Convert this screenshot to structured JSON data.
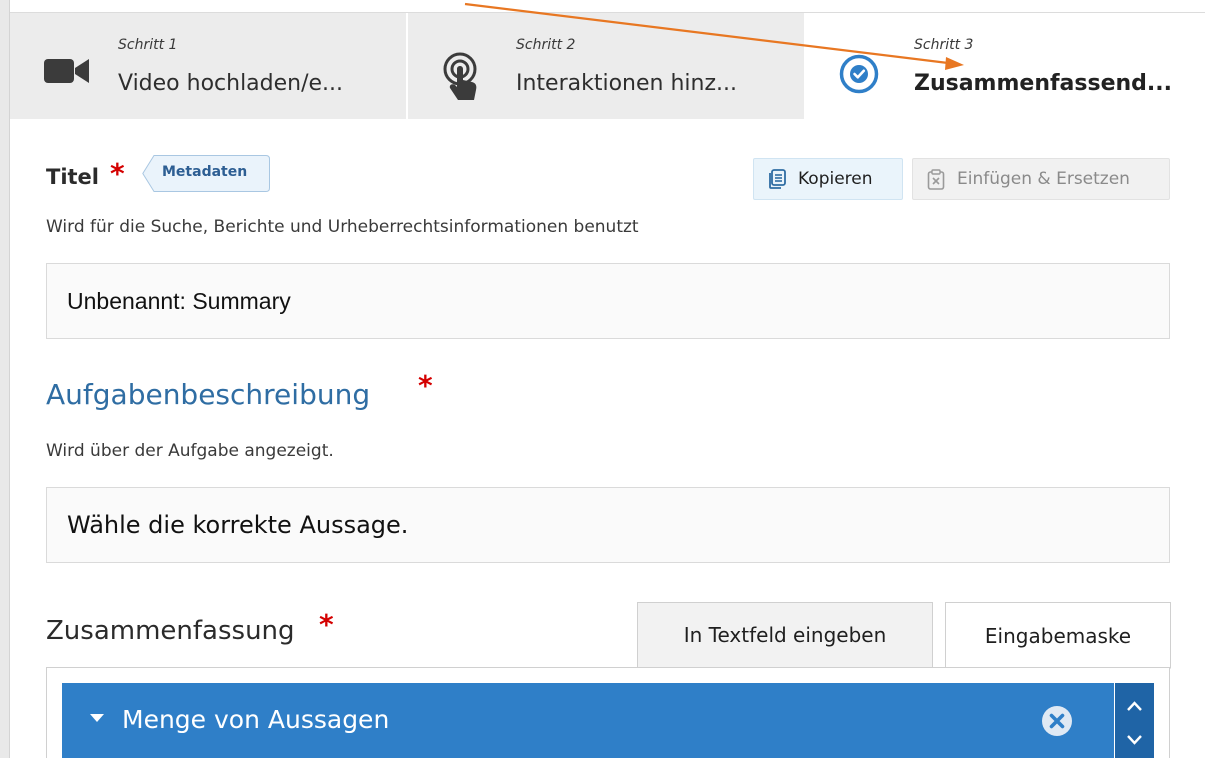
{
  "steps": [
    {
      "number": "Schritt 1",
      "title": "Video hochladen/e...",
      "icon": "video-camera-icon"
    },
    {
      "number": "Schritt 2",
      "title": "Interaktionen hinz...",
      "icon": "touch-pointer-icon"
    },
    {
      "number": "Schritt 3",
      "title": "Zusammenfassend...",
      "icon": "check-circle-icon",
      "active": true
    }
  ],
  "title_field": {
    "label": "Titel",
    "required_mark": "*",
    "metadata_tag": "Metadaten",
    "copy_label": "Kopieren",
    "paste_label": "Einfügen & Ersetzen",
    "help": "Wird für die Suche, Berichte und Urheberrechtsinformationen benutzt",
    "value": "Unbenannt: Summary"
  },
  "task_description": {
    "label": "Aufgabenbeschreibung",
    "required_mark": "*",
    "help": "Wird über der Aufgabe angezeigt.",
    "value": "Wähle die korrekte Aussage."
  },
  "summary": {
    "label": "Zusammenfassung",
    "required_mark": "*",
    "tab_text": "In Textfeld eingeben",
    "tab_form": "Eingabemaske",
    "group_title": "Menge von Aussagen"
  },
  "colors": {
    "accent": "#2f7fc8",
    "heading_blue": "#2f6da3",
    "required_red": "#d40000",
    "annotation_arrow": "#e87722"
  }
}
